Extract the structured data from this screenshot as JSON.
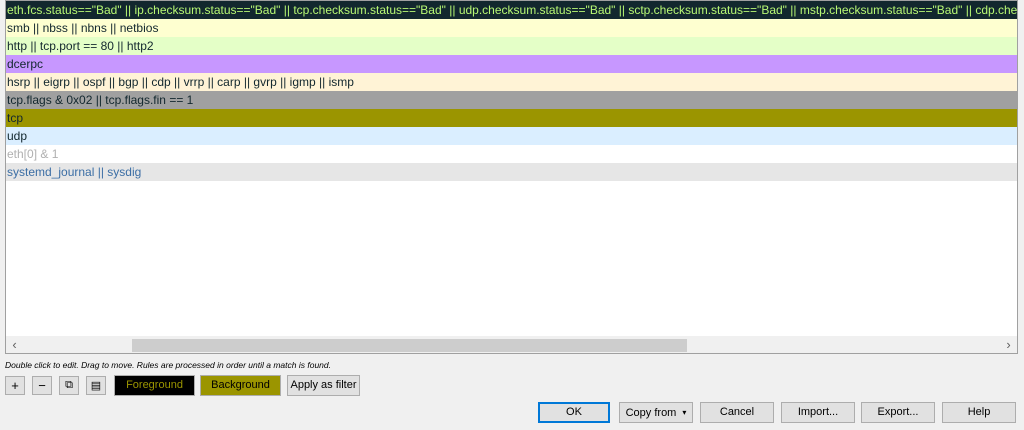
{
  "rules": [
    {
      "filter": "eth.fcs.status==\"Bad\" || ip.checksum.status==\"Bad\" || tcp.checksum.status==\"Bad\" || udp.checksum.status==\"Bad\" || sctp.checksum.status==\"Bad\" || mstp.checksum.status==\"Bad\" || cdp.checksum.status==\"Bad\"",
      "fg": "#b7f774",
      "bg": "#12272e"
    },
    {
      "filter": "smb || nbss || nbns || netbios",
      "fg": "#12272e",
      "bg": "#feffd0"
    },
    {
      "filter": "http || tcp.port == 80 || http2",
      "fg": "#12272e",
      "bg": "#e4ffc7"
    },
    {
      "filter": "dcerpc",
      "fg": "#12272e",
      "bg": "#c797ff"
    },
    {
      "filter": "hsrp || eigrp || ospf || bgp || cdp || vrrp || carp || gvrp || igmp || ismp",
      "fg": "#12272e",
      "bg": "#fff3d6"
    },
    {
      "filter": "tcp.flags & 0x02 || tcp.flags.fin == 1",
      "fg": "#12272e",
      "bg": "#a0a0a0"
    },
    {
      "filter": "tcp",
      "fg": "#12272e",
      "bg": "#9b9500"
    },
    {
      "filter": "udp",
      "fg": "#12272e",
      "bg": "#daeeff"
    },
    {
      "filter": "eth[0] & 1",
      "fg": "#b0b0b0",
      "bg": "#ffffff"
    },
    {
      "filter": "systemd_journal || sysdig",
      "fg": "#3b6ea5",
      "bg": "#e6e6e6"
    }
  ],
  "hint": "Double click to edit. Drag to move. Rules are processed in order until a match is found.",
  "toolbar": {
    "add_icon": "plus-icon",
    "add_glyph": "+",
    "remove_icon": "minus-icon",
    "remove_glyph": "−",
    "copy_icon": "copy-icon",
    "copy_glyph": "⧉",
    "clear_icon": "clear-list-icon",
    "clear_glyph": "▤",
    "foreground_label": "Foreground",
    "background_label": "Background",
    "apply_filter_label": "Apply as filter",
    "foreground_color": "#000000",
    "background_color": "#9b9500"
  },
  "scrollbar": {
    "left_glyph": "‹",
    "right_glyph": "›"
  },
  "buttons": {
    "ok": "OK",
    "copy_from": "Copy from",
    "copy_from_caret": "▾",
    "cancel": "Cancel",
    "import": "Import...",
    "export": "Export...",
    "help": "Help"
  }
}
